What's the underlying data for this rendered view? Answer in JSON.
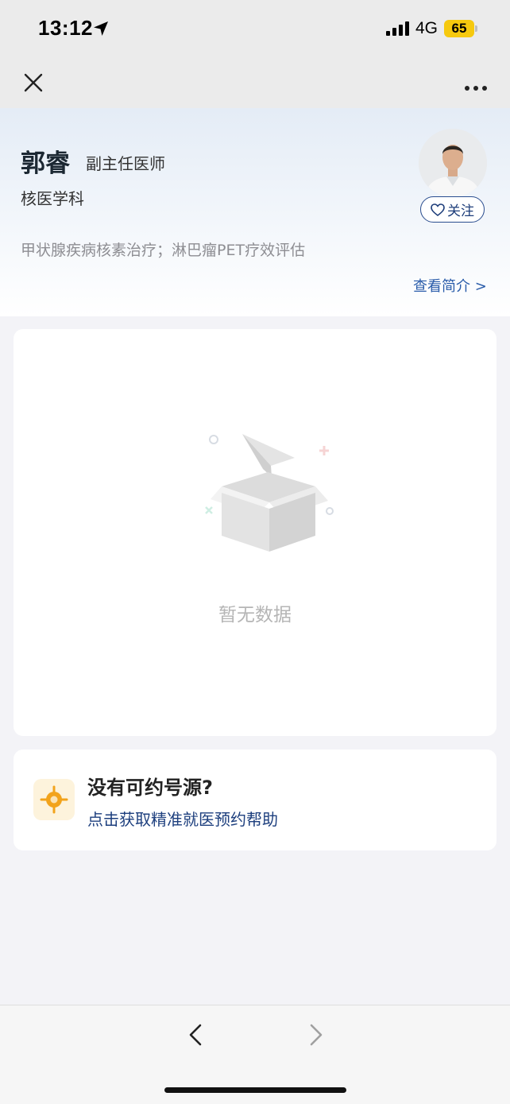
{
  "status_bar": {
    "time": "13:12",
    "network": "4G",
    "battery": "65"
  },
  "doctor": {
    "name": "郭睿",
    "title": "副主任医师",
    "department": "核医学科",
    "specialty": "甲状腺疾病核素治疗；淋巴瘤PET疗效评估",
    "follow_label": "关注",
    "intro_link": "查看简介 >"
  },
  "schedule": {
    "empty_text": "暂无数据"
  },
  "help": {
    "title": "没有可约号源?",
    "link": "点击获取精准就医预约帮助"
  },
  "colors": {
    "accent": "#2a5caa",
    "battery": "#f6c90e",
    "help_icon": "#f2a31b"
  }
}
